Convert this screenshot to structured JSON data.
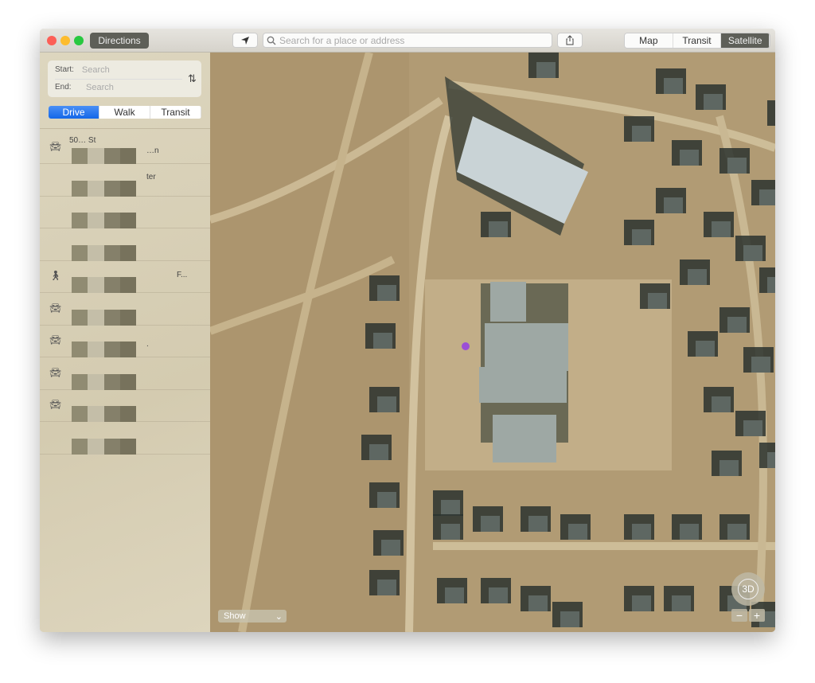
{
  "toolbar": {
    "directions_label": "Directions",
    "search_placeholder": "Search for a place or address",
    "view_modes": [
      {
        "label": "Map",
        "active": false
      },
      {
        "label": "Transit",
        "active": false
      },
      {
        "label": "Satellite",
        "active": true
      }
    ]
  },
  "sidebar": {
    "start_label": "Start:",
    "start_placeholder": "Search",
    "end_label": "End:",
    "end_placeholder": "Search",
    "modes": [
      {
        "label": "Drive",
        "active": true
      },
      {
        "label": "Walk",
        "active": false
      },
      {
        "label": "Transit",
        "active": false
      }
    ],
    "recents": [
      {
        "icon": "car-icon",
        "text": "50…  St",
        "text2": "…n"
      },
      {
        "icon": "",
        "text": "",
        "text2": "ter"
      },
      {
        "icon": "",
        "text": "",
        "text2": ""
      },
      {
        "icon": "",
        "text": "",
        "text2": ""
      },
      {
        "icon": "walk-icon",
        "text": "",
        "text2": "F..."
      },
      {
        "icon": "car-icon",
        "text": "",
        "text2": ""
      },
      {
        "icon": "car-icon",
        "text": "",
        "text2": "."
      },
      {
        "icon": "car-icon",
        "text": "",
        "text2": ""
      },
      {
        "icon": "car-icon",
        "text": "",
        "text2": ""
      },
      {
        "icon": "",
        "text": "",
        "text2": ""
      }
    ]
  },
  "map": {
    "show_label": "Show",
    "three_d_label": "3D",
    "zoom_out": "−",
    "zoom_in": "+",
    "pin_color": "#9b4fd6"
  },
  "colors": {
    "accent": "#1467e8",
    "terrain": "#b59f7a"
  }
}
